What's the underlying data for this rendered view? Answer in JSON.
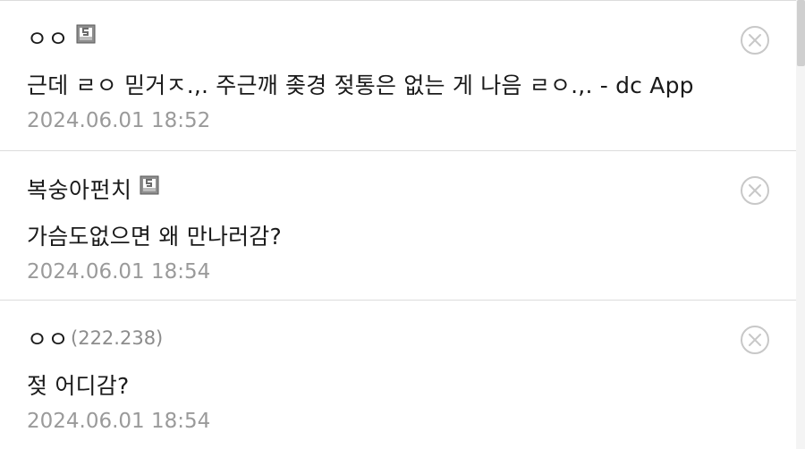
{
  "comments": [
    {
      "nickname": "ㅇㅇ",
      "ip": "",
      "member_badge": "member-badge-icon",
      "text": "근데 ㄹㅇ 믿거ㅈ.,. 주근깨 좆경 젖통은 없는 게 나음 ㄹㅇ.,. - dc App",
      "date": "2024.06.01 18:52"
    },
    {
      "nickname": "복숭아펀치",
      "ip": "",
      "member_badge": "member-badge-icon",
      "text": "가슴도없으면 왜 만나러감?",
      "date": "2024.06.01 18:54"
    },
    {
      "nickname": "ㅇㅇ",
      "ip": "(222.238)",
      "member_badge": "",
      "text": "젖 어디감?",
      "date": "2024.06.01 18:54"
    }
  ],
  "colors": {
    "text": "#1a1a1a",
    "meta": "#9a9a9a",
    "divider": "#dcdcdc",
    "delete_icon": "#c8c8c8"
  }
}
